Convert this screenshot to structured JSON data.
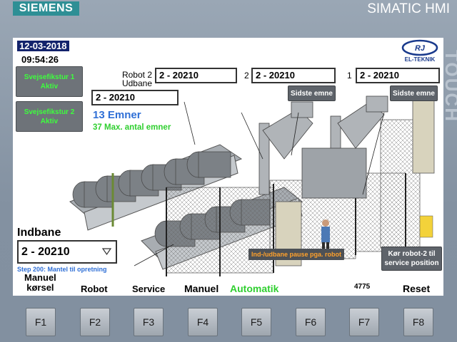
{
  "bezel": {
    "brand_left": "SIEMENS",
    "brand_right": "SIMATIC HMI",
    "touch_text": "TOUCH"
  },
  "header": {
    "date": "12-03-2018",
    "time": "09:54:26",
    "logo_text": "EL-TEKNIK"
  },
  "sidebar": {
    "fixture1": "Svejsefikstur 1 Aktiv",
    "fixture2": "Svejsefikstur 2 Aktiv"
  },
  "robot": {
    "label_line1": "Robot 2",
    "label_line2": "Udbane",
    "field_robot2": "2 - 20210",
    "num2": "2",
    "field_2": "2 - 20210",
    "num1": "1",
    "field_1": "2 - 20210",
    "field_left": "2 - 20210",
    "last_btn_label": "Sidste emne",
    "last_btn_label_2": "Sidste emne"
  },
  "counts": {
    "emner": "13 Emner",
    "max": "37 Max. antal emner"
  },
  "indbane": {
    "label": "Indbane",
    "value": "2 - 20210",
    "step": "Step 200: Mantel til opretning"
  },
  "status": {
    "pause_banner": "Ind-/udbane pause pga. robot",
    "service_btn": "Kør robot-2 til service position"
  },
  "menu": {
    "manuel_korsel_1": "Manuel",
    "manuel_korsel_2": "kørsel",
    "robot": "Robot",
    "service": "Service",
    "manuel": "Manuel",
    "automatik": "Automatik",
    "counter": "4775",
    "reset": "Reset"
  },
  "fkeys": [
    "F1",
    "F2",
    "F3",
    "F4",
    "F5",
    "F6",
    "F7",
    "F8"
  ],
  "colors": {
    "date_bg": "#13236c",
    "active_green": "#3dff3d",
    "emner_blue": "#2f6fd6",
    "automatik_green": "#2fcf2f",
    "pause_orange": "#ffa12b",
    "siemens_teal": "#2e8f95"
  }
}
